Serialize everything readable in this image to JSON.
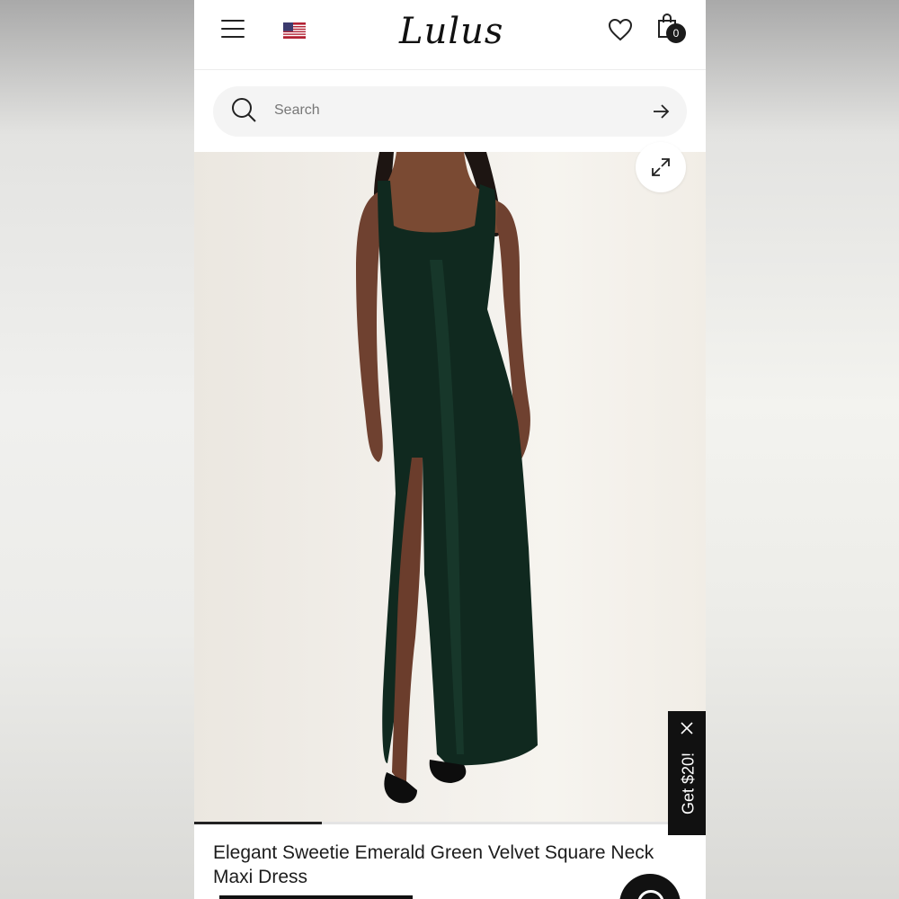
{
  "header": {
    "logo": "Lulus",
    "cart_count": "0",
    "menu_icon": "hamburger-menu-icon",
    "flag_icon": "us-flag-icon",
    "wishlist_icon": "heart-icon",
    "cart_icon": "shopping-bag-icon"
  },
  "search": {
    "placeholder": "Search",
    "icon": "search-icon",
    "submit_icon": "arrow-right-icon"
  },
  "product": {
    "image_alt": "Model wearing emerald green velvet square neck maxi dress",
    "dress_color": "#0f2a22",
    "title": "Elegant Sweetie Emerald Green Velvet Square Neck Maxi Dress",
    "carousel_progress": 0.25,
    "expand_icon": "expand-icon"
  },
  "promo": {
    "label": "Get $20!",
    "close_icon": "close-icon"
  },
  "chat": {
    "icon": "chat-icon"
  }
}
